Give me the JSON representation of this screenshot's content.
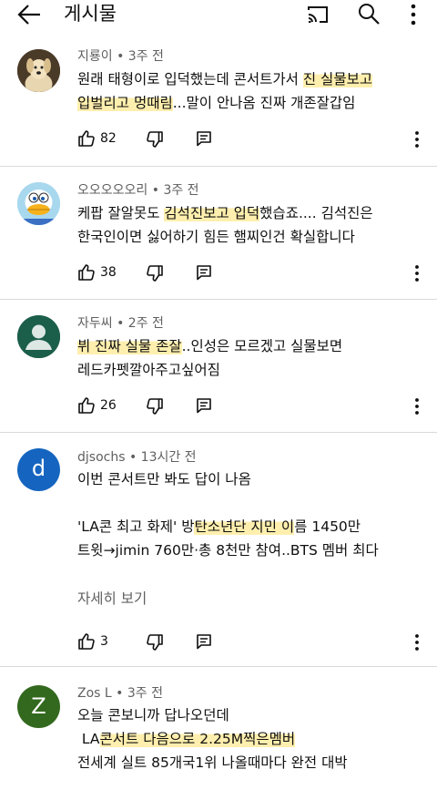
{
  "header": {
    "title": "게시물"
  },
  "comments": [
    {
      "author": "지룡이 • 3주 전",
      "avatar": "dog-photo",
      "lines": [
        [
          {
            "t": "원래 태형이로 입덕했는데 콘서트가서 ",
            "h": false
          },
          {
            "t": "진 실물보고",
            "h": true
          }
        ],
        [
          {
            "t": "입벌리고 멍때림",
            "h": true
          },
          {
            "t": "...말이 안나옴 진짜 개존잘갑임",
            "h": false
          }
        ]
      ],
      "likes": "82"
    },
    {
      "author": "오오오오오리 • 3주 전",
      "avatar": "duck-mascot",
      "lines": [
        [
          {
            "t": "케팝 잘알못도 ",
            "h": false
          },
          {
            "t": "김석진보고 입덕",
            "h": true
          },
          {
            "t": "했습죠.... 김석진은",
            "h": false
          }
        ],
        [
          {
            "t": "한국인이면 싫어하기 힘든 햄찌인건 확실합니다",
            "h": false
          }
        ]
      ],
      "likes": "38"
    },
    {
      "author": "자두씨 • 2주 전",
      "avatar": "default-person",
      "lines": [
        [
          {
            "t": "뷔 진짜 실물 존잘",
            "h": true
          },
          {
            "t": "..인성은 모르겠고 실물보면",
            "h": false
          }
        ],
        [
          {
            "t": "레드카펫깔아주고싶어짐",
            "h": false
          }
        ]
      ],
      "likes": "26"
    },
    {
      "author": "djsochs • 13시간 전",
      "avatar_letter": "d",
      "lines": [
        [
          {
            "t": "이번 콘서트만 봐도 답이 나옴",
            "h": false
          }
        ],
        [
          {
            "t": "",
            "h": false
          }
        ],
        [
          {
            "t": "'LA콘 최고 화제' 방",
            "h": false
          },
          {
            "t": "탄소년단 지민 이",
            "h": true
          },
          {
            "t": "름 1450만",
            "h": false
          }
        ],
        [
          {
            "t": "트윗→jimin 760만·총 8천만 참여..BTS 멤버 최다",
            "h": false
          }
        ]
      ],
      "more": "자세히 보기",
      "likes": "3"
    },
    {
      "author": "Zos L • 3주 전",
      "avatar_letter": "Z",
      "lines": [
        [
          {
            "t": "오늘 콘보니까 답나오던데",
            "h": false
          }
        ],
        [
          {
            "t": " LA",
            "h": false
          },
          {
            "t": "콘서트 다음으로 2.25M찍은멤버",
            "h": true
          }
        ],
        [
          {
            "t": "전세계 실트 85개국1위 나올때마다 완전 대박",
            "h": false
          }
        ]
      ]
    }
  ],
  "colors": {
    "avatar_d": "#1565c0",
    "avatar_z": "#33691e",
    "avatar_person": "#1b5e4a",
    "highlight": "#fff0b0"
  }
}
